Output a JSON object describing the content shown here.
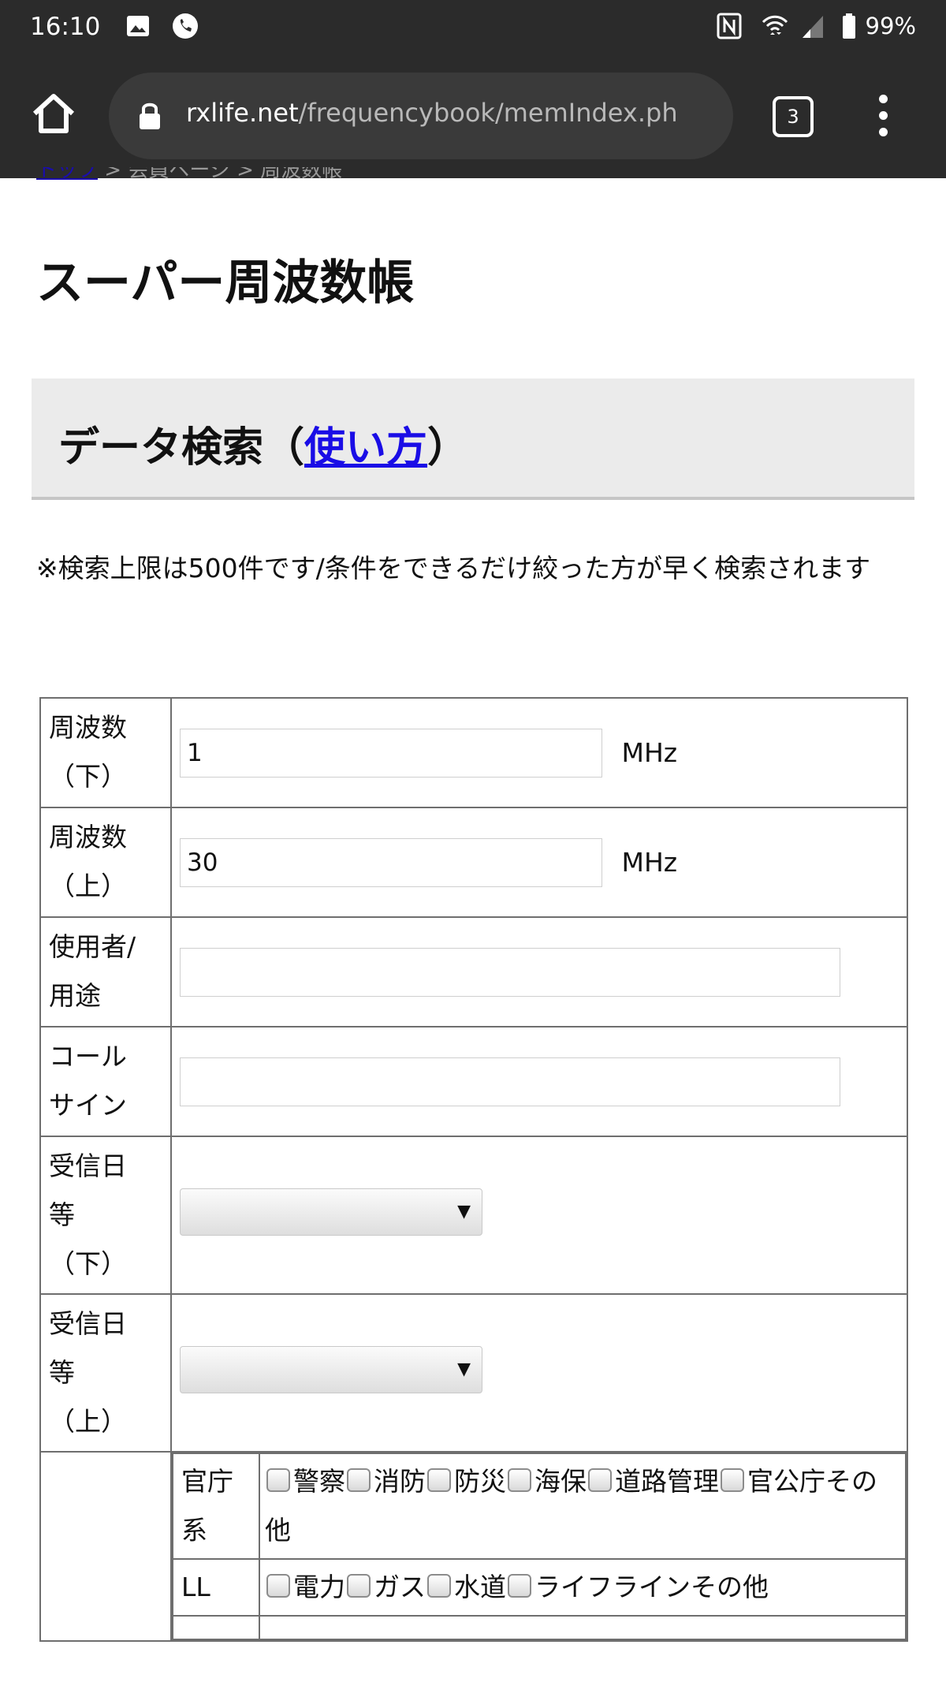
{
  "status_bar": {
    "time": "16:10",
    "battery": "99%",
    "icons": [
      "image-icon",
      "phone-icon",
      "nfc-icon",
      "wifi-icon",
      "signal-icon",
      "battery-icon"
    ]
  },
  "browser": {
    "url_host": "rxlife.net",
    "url_path": "/frequencybook/memIndex.ph",
    "tab_count": "3"
  },
  "page": {
    "breadcrumb": {
      "home": "トップ",
      "middle": "会員ページ",
      "current": "周波数帳"
    },
    "title": "スーパー周波数帳",
    "section": {
      "title_prefix": "データ検索（",
      "link": "使い方",
      "title_suffix": "）"
    },
    "note": "※検索上限は500件です/条件をできるだけ絞った方が早く検索されます"
  },
  "form": {
    "freq_low": {
      "label_line1": "周波数",
      "label_line2": "（下）",
      "value": "1",
      "unit": "MHz"
    },
    "freq_high": {
      "label_line1": "周波数",
      "label_line2": "（上）",
      "value": "30",
      "unit": "MHz"
    },
    "user": {
      "label_line1": "使用者/",
      "label_line2": "用途",
      "value": ""
    },
    "callsign": {
      "label_line1": "コール",
      "label_line2": "サイン",
      "value": ""
    },
    "date_low": {
      "label_line1": "受信日",
      "label_line2": "等",
      "label_line3": "（下）",
      "selected": ""
    },
    "date_high": {
      "label_line1": "受信日",
      "label_line2": "等",
      "label_line3": "（上）",
      "selected": ""
    },
    "category": {
      "groups": [
        {
          "label_line1": "官庁",
          "label_line2": "系",
          "options": [
            "警察",
            "消防",
            "防災",
            "海保",
            "道路管理",
            "官公庁その他"
          ]
        },
        {
          "label_line1": "LL",
          "label_line2": "",
          "options": [
            "電力",
            "ガス",
            "水道",
            "ライフラインその他"
          ]
        }
      ]
    }
  }
}
